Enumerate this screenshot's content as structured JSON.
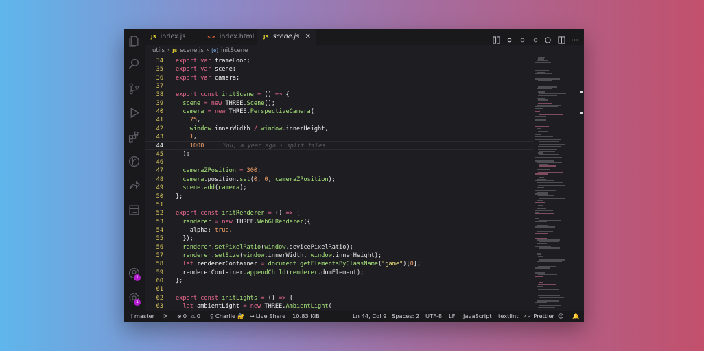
{
  "tabs": [
    {
      "icon": "JS",
      "label": "index.js",
      "active": false
    },
    {
      "icon": "<>",
      "label": "index.html",
      "active": false
    },
    {
      "icon": "JS",
      "label": "scene.js",
      "active": true
    }
  ],
  "tab_close_glyph": "✕",
  "breadcrumb": {
    "folder": "utils",
    "separator1": "›",
    "file_icon": "JS",
    "file": "scene.js",
    "separator2": "›",
    "symbol_icon": "[e]",
    "symbol": "initScene"
  },
  "editor": {
    "current_line": 44,
    "blame_text": "You, a year ago • split files",
    "lines": [
      {
        "num": "34",
        "tokens": [
          [
            "k",
            "export "
          ],
          [
            "k",
            "var "
          ],
          [
            "o",
            "frameLoop;"
          ]
        ]
      },
      {
        "num": "35",
        "tokens": [
          [
            "k",
            "export "
          ],
          [
            "k",
            "var "
          ],
          [
            "o",
            "scene;"
          ]
        ]
      },
      {
        "num": "36",
        "tokens": [
          [
            "k",
            "export "
          ],
          [
            "k",
            "var "
          ],
          [
            "o",
            "camera;"
          ]
        ]
      },
      {
        "num": "37",
        "tokens": []
      },
      {
        "num": "38",
        "tokens": [
          [
            "k",
            "export "
          ],
          [
            "k",
            "const "
          ],
          [
            "fnc",
            "initScene"
          ],
          [
            "o",
            " "
          ],
          [
            "k",
            "="
          ],
          [
            "o",
            " () "
          ],
          [
            "k",
            "=>"
          ],
          [
            "o",
            " {"
          ]
        ]
      },
      {
        "num": "39",
        "tokens": [
          [
            "o",
            "  "
          ],
          [
            "fnc",
            "scene"
          ],
          [
            "o",
            " "
          ],
          [
            "k",
            "="
          ],
          [
            "o",
            " "
          ],
          [
            "k",
            "new "
          ],
          [
            "o",
            "THREE."
          ],
          [
            "fnc",
            "Scene"
          ],
          [
            "o",
            "();"
          ]
        ]
      },
      {
        "num": "40",
        "tokens": [
          [
            "o",
            "  "
          ],
          [
            "fnc",
            "camera"
          ],
          [
            "o",
            " "
          ],
          [
            "k",
            "="
          ],
          [
            "o",
            " "
          ],
          [
            "k",
            "new "
          ],
          [
            "o",
            "THREE."
          ],
          [
            "fnc",
            "PerspectiveCamera"
          ],
          [
            "o",
            "("
          ]
        ]
      },
      {
        "num": "41",
        "tokens": [
          [
            "o",
            "    "
          ],
          [
            "n",
            "75"
          ],
          [
            "o",
            ","
          ]
        ]
      },
      {
        "num": "42",
        "tokens": [
          [
            "o",
            "    "
          ],
          [
            "fnc",
            "window"
          ],
          [
            "o",
            "."
          ],
          [
            "prop",
            "innerWidth"
          ],
          [
            "o",
            " "
          ],
          [
            "k",
            "/"
          ],
          [
            "o",
            " "
          ],
          [
            "fnc",
            "window"
          ],
          [
            "o",
            "."
          ],
          [
            "prop",
            "innerHeight"
          ],
          [
            "o",
            ","
          ]
        ]
      },
      {
        "num": "43",
        "tokens": [
          [
            "o",
            "    "
          ],
          [
            "n",
            "1"
          ],
          [
            "o",
            ","
          ]
        ]
      },
      {
        "num": "44",
        "tokens": [
          [
            "o",
            "    "
          ],
          [
            "n",
            "1000"
          ]
        ]
      },
      {
        "num": "45",
        "tokens": [
          [
            "o",
            "  );"
          ]
        ]
      },
      {
        "num": "46",
        "tokens": []
      },
      {
        "num": "47",
        "tokens": [
          [
            "o",
            "  "
          ],
          [
            "fnc",
            "cameraZPosition"
          ],
          [
            "o",
            " "
          ],
          [
            "k",
            "="
          ],
          [
            "o",
            " "
          ],
          [
            "n",
            "300"
          ],
          [
            "o",
            ";"
          ]
        ]
      },
      {
        "num": "48",
        "tokens": [
          [
            "o",
            "  "
          ],
          [
            "fnc",
            "camera"
          ],
          [
            "o",
            "."
          ],
          [
            "prop",
            "position"
          ],
          [
            "o",
            "."
          ],
          [
            "fnc",
            "set"
          ],
          [
            "o",
            "("
          ],
          [
            "n",
            "0"
          ],
          [
            "o",
            ", "
          ],
          [
            "n",
            "0"
          ],
          [
            "o",
            ", "
          ],
          [
            "fnc",
            "cameraZPosition"
          ],
          [
            "o",
            ");"
          ]
        ]
      },
      {
        "num": "49",
        "tokens": [
          [
            "o",
            "  "
          ],
          [
            "fnc",
            "scene"
          ],
          [
            "o",
            "."
          ],
          [
            "fnc",
            "add"
          ],
          [
            "o",
            "("
          ],
          [
            "fnc",
            "camera"
          ],
          [
            "o",
            ");"
          ]
        ]
      },
      {
        "num": "50",
        "tokens": [
          [
            "o",
            "};"
          ]
        ]
      },
      {
        "num": "51",
        "tokens": []
      },
      {
        "num": "52",
        "tokens": [
          [
            "k",
            "export "
          ],
          [
            "k",
            "const "
          ],
          [
            "fnc",
            "initRenderer"
          ],
          [
            "o",
            " "
          ],
          [
            "k",
            "="
          ],
          [
            "o",
            " () "
          ],
          [
            "k",
            "=>"
          ],
          [
            "o",
            " {"
          ]
        ]
      },
      {
        "num": "53",
        "tokens": [
          [
            "o",
            "  "
          ],
          [
            "fnc",
            "renderer"
          ],
          [
            "o",
            " "
          ],
          [
            "k",
            "="
          ],
          [
            "o",
            " "
          ],
          [
            "k",
            "new "
          ],
          [
            "o",
            "THREE."
          ],
          [
            "fnc",
            "WebGLRenderer"
          ],
          [
            "o",
            "({"
          ]
        ]
      },
      {
        "num": "54",
        "tokens": [
          [
            "o",
            "    "
          ],
          [
            "prop",
            "alpha"
          ],
          [
            "o",
            ": "
          ],
          [
            "n",
            "true"
          ],
          [
            "o",
            ","
          ]
        ]
      },
      {
        "num": "55",
        "tokens": [
          [
            "o",
            "  });"
          ]
        ]
      },
      {
        "num": "56",
        "tokens": [
          [
            "o",
            "  "
          ],
          [
            "fnc",
            "renderer"
          ],
          [
            "o",
            "."
          ],
          [
            "fnc",
            "setPixelRatio"
          ],
          [
            "o",
            "("
          ],
          [
            "fnc",
            "window"
          ],
          [
            "o",
            "."
          ],
          [
            "prop",
            "devicePixelRatio"
          ],
          [
            "o",
            ");"
          ]
        ]
      },
      {
        "num": "57",
        "tokens": [
          [
            "o",
            "  "
          ],
          [
            "fnc",
            "renderer"
          ],
          [
            "o",
            "."
          ],
          [
            "fnc",
            "setSize"
          ],
          [
            "o",
            "("
          ],
          [
            "fnc",
            "window"
          ],
          [
            "o",
            "."
          ],
          [
            "prop",
            "innerWidth"
          ],
          [
            "o",
            ", "
          ],
          [
            "fnc",
            "window"
          ],
          [
            "o",
            "."
          ],
          [
            "prop",
            "innerHeight"
          ],
          [
            "o",
            ");"
          ]
        ]
      },
      {
        "num": "58",
        "tokens": [
          [
            "o",
            "  "
          ],
          [
            "k",
            "let "
          ],
          [
            "o",
            "rendererContainer "
          ],
          [
            "k",
            "="
          ],
          [
            "o",
            " "
          ],
          [
            "fnc",
            "document"
          ],
          [
            "o",
            "."
          ],
          [
            "fnc",
            "getElementsByClassName"
          ],
          [
            "o",
            "("
          ],
          [
            "s",
            "\"game\""
          ],
          [
            "o",
            ")["
          ],
          [
            "n",
            "0"
          ],
          [
            "o",
            "];"
          ]
        ]
      },
      {
        "num": "59",
        "tokens": [
          [
            "o",
            "  "
          ],
          [
            "o",
            "rendererContainer."
          ],
          [
            "fnc",
            "appendChild"
          ],
          [
            "o",
            "("
          ],
          [
            "fnc",
            "renderer"
          ],
          [
            "o",
            "."
          ],
          [
            "prop",
            "domElement"
          ],
          [
            "o",
            ");"
          ]
        ]
      },
      {
        "num": "60",
        "tokens": [
          [
            "o",
            "};"
          ]
        ]
      },
      {
        "num": "61",
        "tokens": []
      },
      {
        "num": "62",
        "tokens": [
          [
            "k",
            "export "
          ],
          [
            "k",
            "const "
          ],
          [
            "fnc",
            "initLights"
          ],
          [
            "o",
            " "
          ],
          [
            "k",
            "="
          ],
          [
            "o",
            " () "
          ],
          [
            "k",
            "=>"
          ],
          [
            "o",
            " {"
          ]
        ]
      },
      {
        "num": "63",
        "tokens": [
          [
            "o",
            "  "
          ],
          [
            "k",
            "let "
          ],
          [
            "o",
            "ambientLight "
          ],
          [
            "k",
            "="
          ],
          [
            "o",
            " "
          ],
          [
            "k",
            "new "
          ],
          [
            "o",
            "THREE."
          ],
          [
            "fnc",
            "AmbientLight"
          ],
          [
            "o",
            "("
          ]
        ]
      }
    ]
  },
  "activity_badges": [
    "1",
    "1"
  ],
  "statusbar": {
    "branch": "master",
    "errors": "0",
    "warnings": "0",
    "user": "Charlie",
    "live_share": "Live Share",
    "file_size": "10.83 KiB",
    "position": "Ln 44, Col 9",
    "spaces": "Spaces: 2",
    "encoding": "UTF-8",
    "eol": "LF",
    "language": "JavaScript",
    "linter": "textlint",
    "formatter": "Prettier"
  },
  "colors": {
    "keyword": "#ea6a8e",
    "function": "#a7e37a",
    "number": "#f3a069",
    "line_number": "#d8c55a",
    "badge": "#b41dcf"
  }
}
